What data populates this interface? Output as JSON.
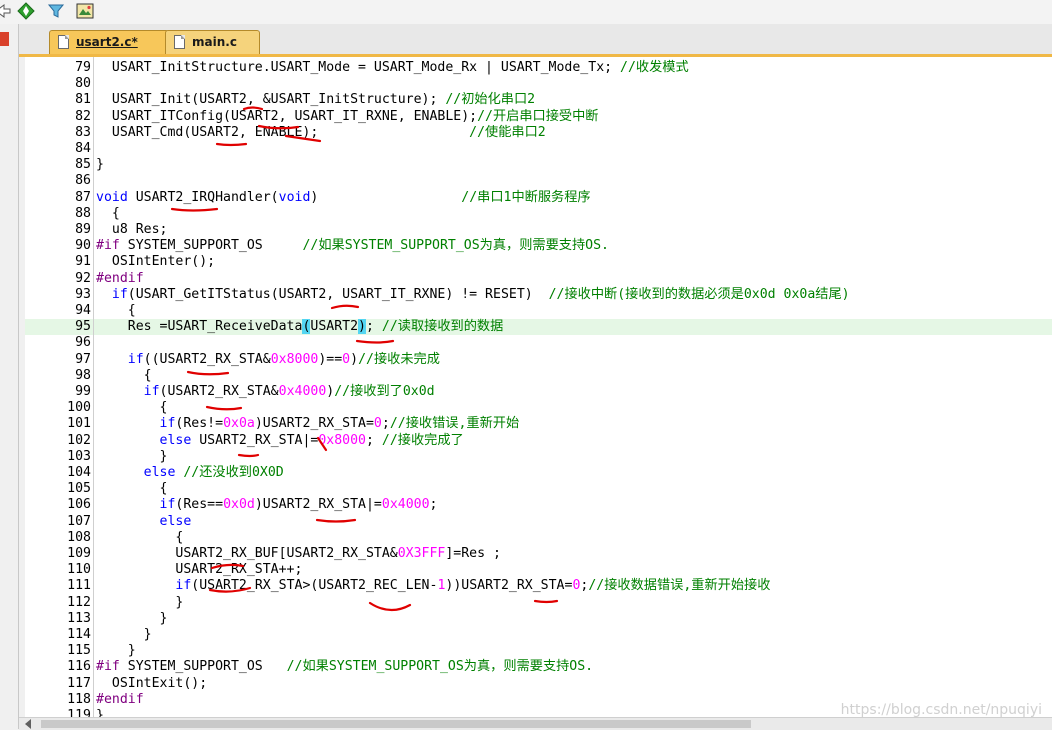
{
  "toolbar": {
    "icons": [
      "arrow-icon",
      "diamond-arrows-icon",
      "funnel-icon",
      "grid-image-icon"
    ]
  },
  "tabs": [
    {
      "label": "usart2.c*",
      "active": true
    },
    {
      "label": "main.c",
      "active": false
    }
  ],
  "editor": {
    "current_line": 95,
    "lines": [
      {
        "n": "79",
        "tokens": [
          {
            "t": "  USART_InitStructure.USART_Mode = USART_Mode_Rx | USART_Mode_Tx; "
          },
          {
            "t": "//收发模式",
            "c": "cmt"
          }
        ]
      },
      {
        "n": "80",
        "tokens": []
      },
      {
        "n": "81",
        "tokens": [
          {
            "t": "  USART_Init(USART2, &USART_InitStructure); "
          },
          {
            "t": "//初始化串口2",
            "c": "cmt"
          }
        ]
      },
      {
        "n": "82",
        "tokens": [
          {
            "t": "  USART_ITConfig(USART2, USART_IT_RXNE, ENABLE);"
          },
          {
            "t": "//开启串口接受中断",
            "c": "cmt"
          }
        ]
      },
      {
        "n": "83",
        "tokens": [
          {
            "t": "  USART_Cmd(USART2, ENABLE);                   "
          },
          {
            "t": "//使能串口2",
            "c": "cmt"
          }
        ]
      },
      {
        "n": "84",
        "tokens": []
      },
      {
        "n": "85",
        "tokens": [
          {
            "t": "}"
          }
        ]
      },
      {
        "n": "86",
        "tokens": []
      },
      {
        "n": "87",
        "tokens": [
          {
            "t": "void",
            "c": "kw"
          },
          {
            "t": " USART2_IRQHandler("
          },
          {
            "t": "void",
            "c": "kw"
          },
          {
            "t": ")                  "
          },
          {
            "t": "//串口1中断服务程序",
            "c": "cmt"
          }
        ]
      },
      {
        "n": "88",
        "tokens": [
          {
            "t": "  {"
          }
        ]
      },
      {
        "n": "89",
        "tokens": [
          {
            "t": "  u8 Res;"
          }
        ]
      },
      {
        "n": "90",
        "tokens": [
          {
            "t": "#if",
            "c": "pp"
          },
          {
            "t": " SYSTEM_SUPPORT_OS     "
          },
          {
            "t": "//如果SYSTEM_SUPPORT_OS为真，则需要支持OS.",
            "c": "cmt"
          }
        ]
      },
      {
        "n": "91",
        "tokens": [
          {
            "t": "  OSIntEnter();"
          }
        ]
      },
      {
        "n": "92",
        "tokens": [
          {
            "t": "#endif",
            "c": "pp"
          }
        ]
      },
      {
        "n": "93",
        "tokens": [
          {
            "t": "  "
          },
          {
            "t": "if",
            "c": "kw"
          },
          {
            "t": "(USART_GetITStatus(USART2, USART_IT_RXNE) != RESET)  "
          },
          {
            "t": "//接收中断(接收到的数据必须是0x0d 0x0a结尾)",
            "c": "cmt"
          }
        ]
      },
      {
        "n": "94",
        "tokens": [
          {
            "t": "    {"
          }
        ]
      },
      {
        "n": "95",
        "tokens": [
          {
            "t": "    Res =USART_ReceiveData"
          },
          {
            "t": "(",
            "c": "br"
          },
          {
            "t": "USART2"
          },
          {
            "t": ")",
            "c": "br"
          },
          {
            "t": "; "
          },
          {
            "t": "//读取接收到的数据",
            "c": "cmt"
          }
        ]
      },
      {
        "n": "96",
        "tokens": []
      },
      {
        "n": "97",
        "tokens": [
          {
            "t": "    "
          },
          {
            "t": "if",
            "c": "kw"
          },
          {
            "t": "((USART2_RX_STA&"
          },
          {
            "t": "0x8000",
            "c": "num"
          },
          {
            "t": ")=="
          },
          {
            "t": "0",
            "c": "num"
          },
          {
            "t": ")"
          },
          {
            "t": "//接收未完成",
            "c": "cmt"
          }
        ]
      },
      {
        "n": "98",
        "tokens": [
          {
            "t": "      {"
          }
        ]
      },
      {
        "n": "99",
        "tokens": [
          {
            "t": "      "
          },
          {
            "t": "if",
            "c": "kw"
          },
          {
            "t": "(USART2_RX_STA&"
          },
          {
            "t": "0x4000",
            "c": "num"
          },
          {
            "t": ")"
          },
          {
            "t": "//接收到了0x0d",
            "c": "cmt"
          }
        ]
      },
      {
        "n": "100",
        "tokens": [
          {
            "t": "        {"
          }
        ]
      },
      {
        "n": "101",
        "tokens": [
          {
            "t": "        "
          },
          {
            "t": "if",
            "c": "kw"
          },
          {
            "t": "(Res!="
          },
          {
            "t": "0x0a",
            "c": "num"
          },
          {
            "t": ")USART2_RX_STA="
          },
          {
            "t": "0",
            "c": "num"
          },
          {
            "t": ";"
          },
          {
            "t": "//接收错误,重新开始",
            "c": "cmt"
          }
        ]
      },
      {
        "n": "102",
        "tokens": [
          {
            "t": "        "
          },
          {
            "t": "else",
            "c": "kw"
          },
          {
            "t": " USART2_RX_STA|="
          },
          {
            "t": "0x8000",
            "c": "num"
          },
          {
            "t": "; "
          },
          {
            "t": "//接收完成了",
            "c": "cmt"
          }
        ]
      },
      {
        "n": "103",
        "tokens": [
          {
            "t": "        }"
          }
        ]
      },
      {
        "n": "104",
        "tokens": [
          {
            "t": "      "
          },
          {
            "t": "else",
            "c": "kw"
          },
          {
            "t": " "
          },
          {
            "t": "//还没收到0X0D",
            "c": "cmt"
          }
        ]
      },
      {
        "n": "105",
        "tokens": [
          {
            "t": "        {"
          }
        ]
      },
      {
        "n": "106",
        "tokens": [
          {
            "t": "        "
          },
          {
            "t": "if",
            "c": "kw"
          },
          {
            "t": "(Res=="
          },
          {
            "t": "0x0d",
            "c": "num"
          },
          {
            "t": ")USART2_RX_STA|="
          },
          {
            "t": "0x4000",
            "c": "num"
          },
          {
            "t": ";"
          }
        ]
      },
      {
        "n": "107",
        "tokens": [
          {
            "t": "        "
          },
          {
            "t": "else",
            "c": "kw"
          }
        ]
      },
      {
        "n": "108",
        "tokens": [
          {
            "t": "          {"
          }
        ]
      },
      {
        "n": "109",
        "tokens": [
          {
            "t": "          USART2_RX_BUF[USART2_RX_STA&"
          },
          {
            "t": "0X3FFF",
            "c": "num"
          },
          {
            "t": "]=Res ;"
          }
        ]
      },
      {
        "n": "110",
        "tokens": [
          {
            "t": "          USART2_RX_STA++;"
          }
        ]
      },
      {
        "n": "111",
        "tokens": [
          {
            "t": "          "
          },
          {
            "t": "if",
            "c": "kw"
          },
          {
            "t": "(USART2_RX_STA>(USART2_REC_LEN-"
          },
          {
            "t": "1",
            "c": "num"
          },
          {
            "t": "))USART2_RX_STA="
          },
          {
            "t": "0",
            "c": "num"
          },
          {
            "t": ";"
          },
          {
            "t": "//接收数据错误,重新开始接收",
            "c": "cmt"
          }
        ]
      },
      {
        "n": "112",
        "tokens": [
          {
            "t": "          }"
          }
        ]
      },
      {
        "n": "113",
        "tokens": [
          {
            "t": "        }"
          }
        ]
      },
      {
        "n": "114",
        "tokens": [
          {
            "t": "      }"
          }
        ]
      },
      {
        "n": "115",
        "tokens": [
          {
            "t": "    }"
          }
        ]
      },
      {
        "n": "116",
        "tokens": [
          {
            "t": "#if",
            "c": "pp"
          },
          {
            "t": " SYSTEM_SUPPORT_OS   "
          },
          {
            "t": "//如果SYSTEM_SUPPORT_OS为真，则需要支持OS.",
            "c": "cmt"
          }
        ]
      },
      {
        "n": "117",
        "tokens": [
          {
            "t": "  OSIntExit();"
          }
        ]
      },
      {
        "n": "118",
        "tokens": [
          {
            "t": "#endif",
            "c": "pp"
          }
        ]
      },
      {
        "n": "119",
        "tokens": [
          {
            "t": "}"
          }
        ]
      }
    ]
  },
  "watermark": "https://blog.csdn.net/npuqiyi",
  "colors": {
    "keyword": "#0000ff",
    "number": "#ff00ff",
    "comment": "#008000",
    "preprocessor": "#800080",
    "current_line": "#e5f7e5",
    "annotation": "#e00000",
    "active_tab": "#f7c75a"
  }
}
